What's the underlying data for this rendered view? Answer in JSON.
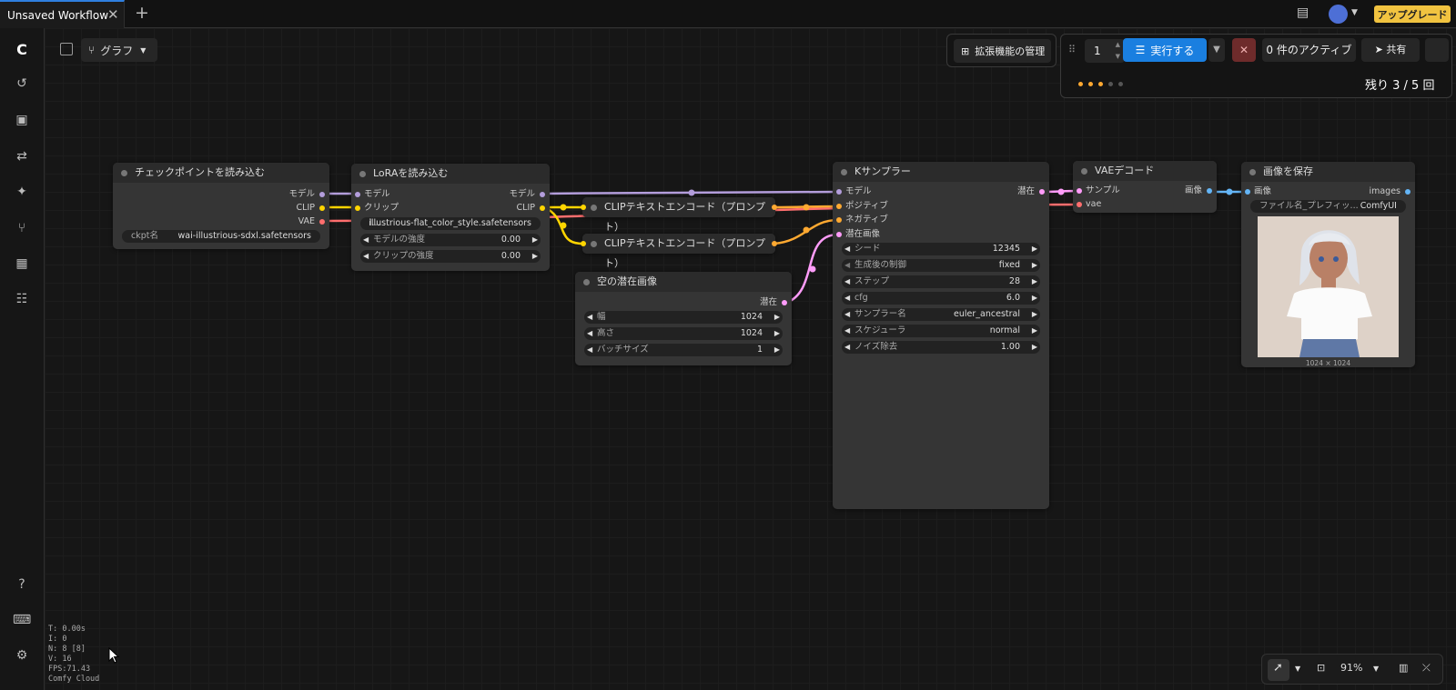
{
  "topbar": {
    "tab_title": "Unsaved Workflow",
    "upgrade_label": "アップグレード"
  },
  "canvas_header": {
    "graph_label": "グラフ",
    "extensions_label": "拡張機能の管理"
  },
  "run_panel": {
    "quantity": "1",
    "run_label": "実行する",
    "active_label": "0 件のアクティブ",
    "share_label": "共有",
    "remaining": "残り 3 / 5 回"
  },
  "nodes": {
    "checkpoint": {
      "title": "チェックポイントを読み込む",
      "out_model": "モデル",
      "out_clip": "CLIP",
      "out_vae": "VAE",
      "ckpt_label": "ckpt名",
      "ckpt_value": "wai-illustrious-sdxl.safetensors"
    },
    "lora": {
      "title": "LoRAを読み込む",
      "in_model": "モデル",
      "in_clip": "クリップ",
      "out_model": "モデル",
      "out_clip": "CLIP",
      "lora_prefix": "l...",
      "lora_value": "illustrious-flat_color_style.safetensors",
      "model_strength_label": "モデルの強度",
      "model_strength_value": "0.00",
      "clip_strength_label": "クリップの強度",
      "clip_strength_value": "0.00"
    },
    "clip_pos": {
      "title": "CLIPテキストエンコード（プロンプト）"
    },
    "clip_neg": {
      "title": "CLIPテキストエンコード（プロンプト）"
    },
    "empty_latent": {
      "title": "空の潜在画像",
      "out_latent": "潜在",
      "width_label": "幅",
      "width_value": "1024",
      "height_label": "高さ",
      "height_value": "1024",
      "batch_label": "バッチサイズ",
      "batch_value": "1"
    },
    "ksampler": {
      "title": "Kサンプラー",
      "in_model": "モデル",
      "in_positive": "ポジティブ",
      "in_negative": "ネガティブ",
      "in_latent": "潜在画像",
      "out_latent": "潜在",
      "seed_label": "シード",
      "seed_value": "12345",
      "control_label": "生成後の制御",
      "control_value": "fixed",
      "steps_label": "ステップ",
      "steps_value": "28",
      "cfg_label": "cfg",
      "cfg_value": "6.0",
      "sampler_label": "サンプラー名",
      "sampler_value": "euler_ancestral",
      "scheduler_label": "スケジューラ",
      "scheduler_value": "normal",
      "denoise_label": "ノイズ除去",
      "denoise_value": "1.00"
    },
    "vae_decode": {
      "title": "VAEデコード",
      "in_samples": "サンプル",
      "in_vae": "vae",
      "out_image": "画像"
    },
    "save_image": {
      "title": "画像を保存",
      "in_images": "画像",
      "out_images": "images",
      "prefix_label": "ファイル名_プレフィッ...",
      "prefix_value": "ComfyUI",
      "image_size": "1024 × 1024"
    }
  },
  "stats": {
    "t": "T: 0.00s",
    "i": "I: 0",
    "n": "N: 8 [8]",
    "v": "V: 16",
    "fps": "FPS:71.43",
    "env": "Comfy Cloud"
  },
  "zoom": "91%",
  "colors": {
    "model": "#b39ddb",
    "clip": "#ffd500",
    "vae": "#ff6e6e",
    "conditioning": "#ffa931",
    "latent": "#ff9cf9",
    "image": "#64b5f6",
    "run": "#1a7fe0",
    "upgrade": "#f1c340"
  }
}
